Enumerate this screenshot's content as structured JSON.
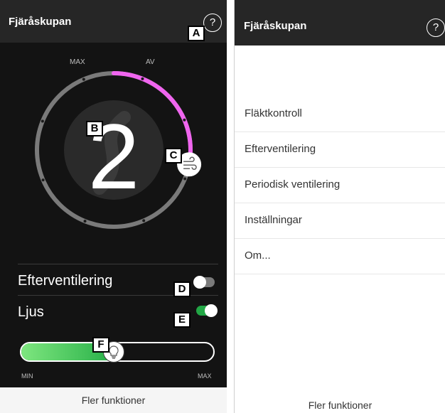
{
  "left": {
    "title": "Fjäråskupan",
    "help_symbol": "?",
    "dial": {
      "max_label": "MAX",
      "off_label": "AV",
      "value": "2",
      "fan_level_fraction": 0.28,
      "accent_color": "#f065ef"
    },
    "rows": [
      {
        "label": "Efterventilering",
        "on": false
      },
      {
        "label": "Ljus",
        "on": true
      }
    ],
    "slider": {
      "min_label": "MIN",
      "max_label": "MAX",
      "value_fraction": 0.48
    },
    "footer": "Fler funktioner",
    "callouts": [
      "A",
      "B",
      "C",
      "D",
      "E",
      "F"
    ]
  },
  "right": {
    "title": "Fjäråskupan",
    "help_symbol": "?",
    "menu": [
      "Fläktkontroll",
      "Efterventilering",
      "Periodisk ventilering",
      "Inställningar",
      "Om..."
    ],
    "footer": "Fler funktioner"
  },
  "colors": {
    "toggle_on": "#22a645",
    "toggle_off": "#7a7a7a",
    "bar": "#262626"
  }
}
